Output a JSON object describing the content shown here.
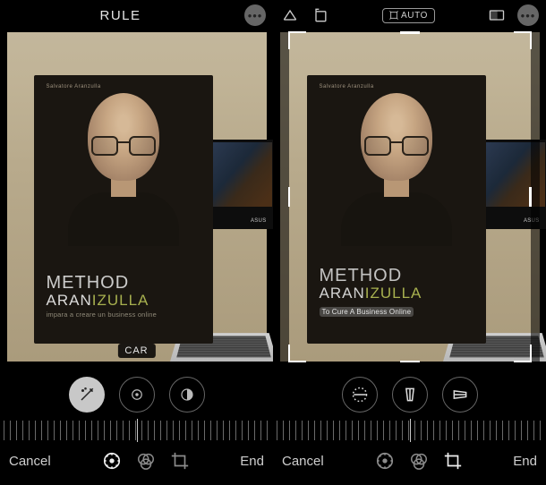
{
  "left": {
    "header": {
      "title": "RULE"
    },
    "book": {
      "topcaption": "Salvatore Aranzulla",
      "line1": "METHOD",
      "line2a": "ARAN",
      "line2b": "IZULLA",
      "line3": "impara a creare un business online"
    },
    "monitorBrand": "ASUS",
    "overlayTag": "CAR",
    "bottom": {
      "cancel": "Cancel",
      "end": "End"
    }
  },
  "right": {
    "header": {
      "auto": "AUTO"
    },
    "book": {
      "topcaption": "Salvatore Aranzulla",
      "line1": "METHOD",
      "line2a": "ARAN",
      "line2b": "IZULLA",
      "line3": "To Cure A Business Online"
    },
    "monitorBrand": "ASUS",
    "bottom": {
      "cancel": "Cancel",
      "end": "End"
    }
  }
}
